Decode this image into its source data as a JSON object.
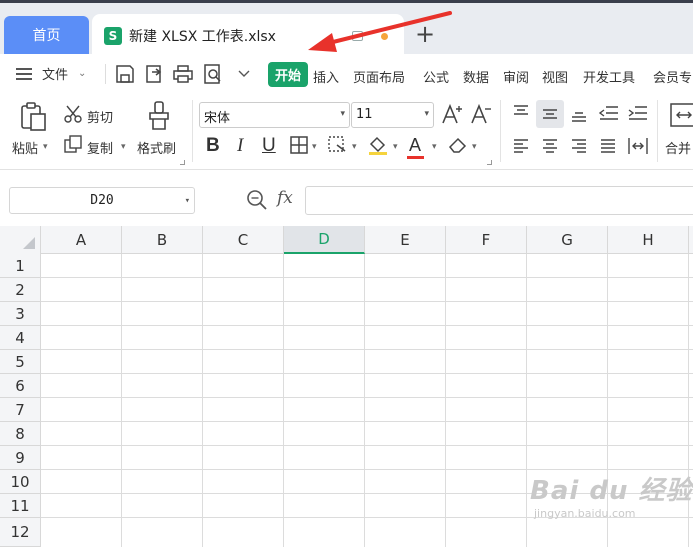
{
  "tabs": {
    "home_label": "首页",
    "file_badge": "S",
    "file_title": "新建 XLSX 工作表.xlsx",
    "new_tab_label": "+"
  },
  "menu": {
    "file_label": "文件",
    "items": [
      "开始",
      "插入",
      "页面布局",
      "公式",
      "数据",
      "审阅",
      "视图",
      "开发工具",
      "会员专"
    ]
  },
  "ribbon": {
    "paste_label": "粘贴",
    "cut_label": "剪切",
    "copy_label": "复制",
    "format_painter_label": "格式刷",
    "font_name": "宋体",
    "font_size": "11",
    "bold_glyph": "B",
    "italic_glyph": "I",
    "underline_glyph": "U",
    "font_color_glyph": "A",
    "merge_label": "合并"
  },
  "formula_bar": {
    "cell_ref": "D20",
    "fx_label": "fx",
    "formula": ""
  },
  "sheet": {
    "columns": [
      "A",
      "B",
      "C",
      "D",
      "E",
      "F",
      "G",
      "H"
    ],
    "active_column": "D",
    "rows": [
      "1",
      "2",
      "3",
      "4",
      "5",
      "6",
      "7",
      "8",
      "9",
      "10",
      "11",
      "12"
    ]
  },
  "watermark": {
    "main": "Bai du 经验",
    "sub": "jingyan.baidu.com"
  },
  "colors": {
    "accent_green": "#1aa36a",
    "home_tab_blue": "#5b8ef7",
    "annotation_red": "#e8322b"
  }
}
